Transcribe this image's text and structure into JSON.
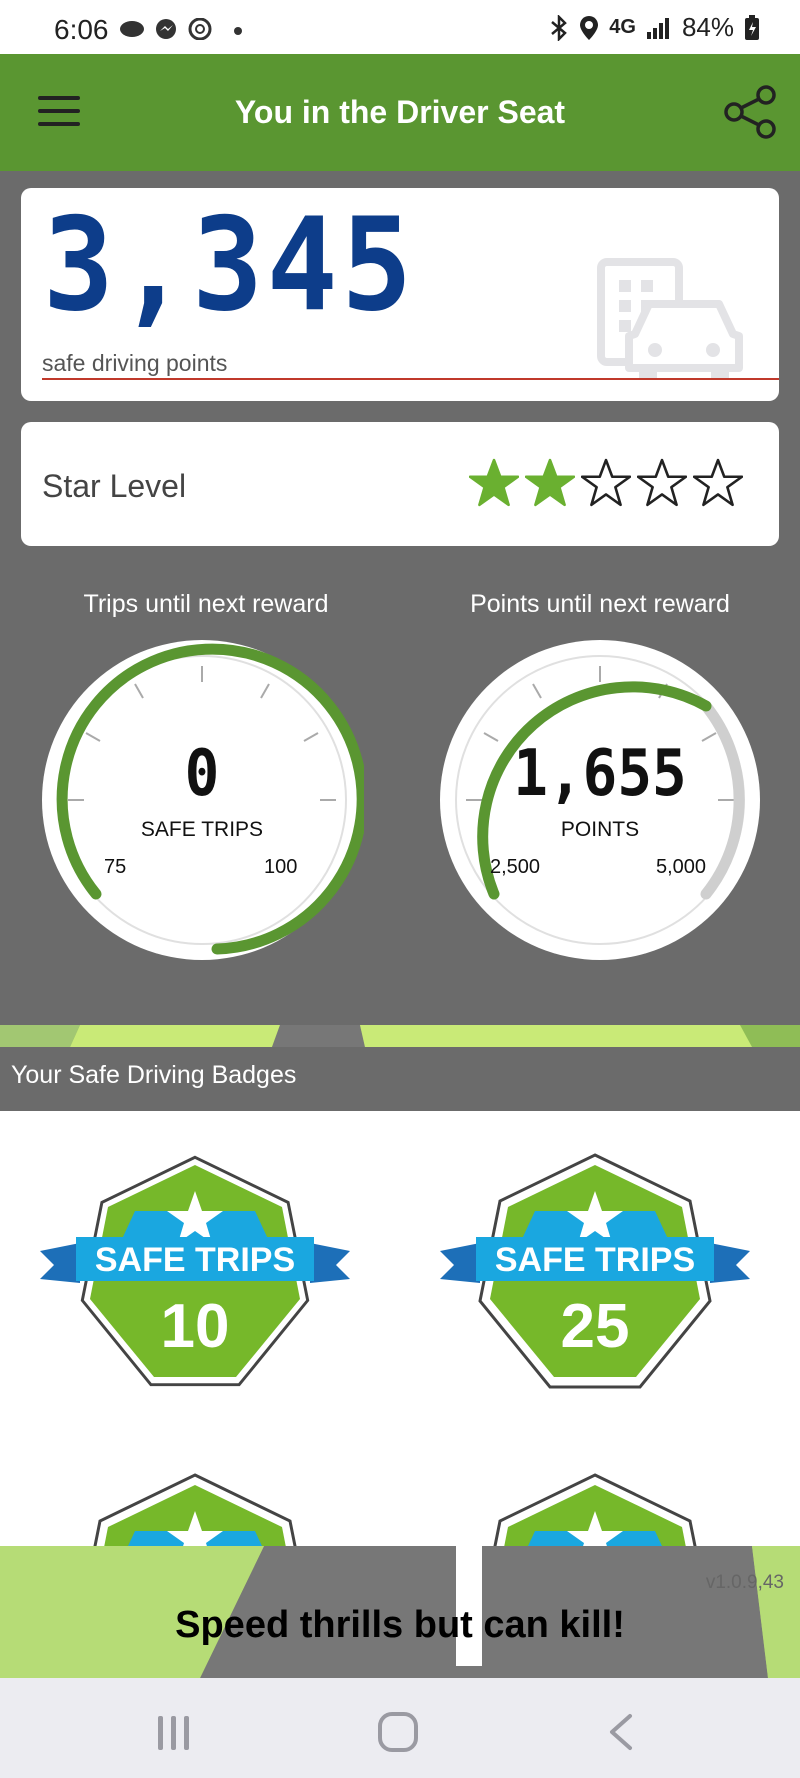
{
  "status_bar": {
    "time": "6:06",
    "network": "4G",
    "battery": "84%"
  },
  "app_bar": {
    "title": "You in the Driver Seat"
  },
  "points_card": {
    "value": "3,345",
    "label": "safe driving points"
  },
  "star_card": {
    "label": "Star Level",
    "filled_stars": 2,
    "total_stars": 5
  },
  "gauges": [
    {
      "title": "Trips until next reward",
      "value": "0",
      "unit": "SAFE TRIPS",
      "min_label": "75",
      "max_label": "100"
    },
    {
      "title": "Points until next reward",
      "value": "1,655",
      "unit": "POINTS",
      "min_label": "2,500",
      "max_label": "5,000"
    }
  ],
  "badges": {
    "header": "Your Safe Driving Badges",
    "items": [
      {
        "label": "SAFE TRIPS",
        "number": "10"
      },
      {
        "label": "SAFE TRIPS",
        "number": "25"
      }
    ]
  },
  "banner": {
    "message": "Speed thrills but can kill!",
    "version": "v1.0.9,43"
  },
  "colors": {
    "app_green": "#5a9631",
    "points_blue": "#0d3d8a",
    "gauge_green": "#5a9631",
    "background_gray": "#6b6b6b",
    "star_green": "#6ab030"
  }
}
